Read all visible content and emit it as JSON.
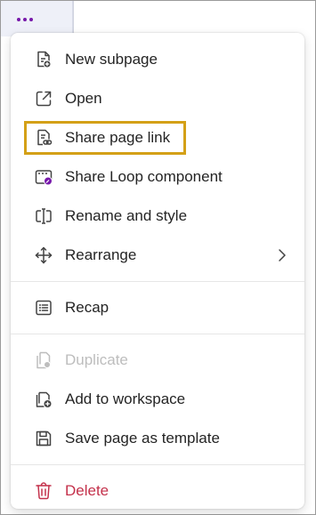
{
  "colors": {
    "accent": "#7719aa",
    "highlight_border": "#d4a017",
    "danger": "#c4314b",
    "disabled": "#bdbdbd"
  },
  "toolbar": {
    "more_icon": "more-horizontal-icon"
  },
  "menu": {
    "groups": [
      [
        {
          "label": "New subpage",
          "icon": "new-subpage-icon"
        },
        {
          "label": "Open",
          "icon": "open-external-icon"
        },
        {
          "label": "Share page link",
          "icon": "share-link-icon",
          "highlighted": true
        },
        {
          "label": "Share Loop component",
          "icon": "loop-component-icon"
        },
        {
          "label": "Rename and style",
          "icon": "rename-icon"
        },
        {
          "label": "Rearrange",
          "icon": "arrange-move-icon",
          "submenu": true
        }
      ],
      [
        {
          "label": "Recap",
          "icon": "recap-list-icon"
        }
      ],
      [
        {
          "label": "Duplicate",
          "icon": "duplicate-icon",
          "disabled": true
        },
        {
          "label": "Add to workspace",
          "icon": "add-to-workspace-icon"
        },
        {
          "label": "Save page as template",
          "icon": "save-template-icon"
        }
      ],
      [
        {
          "label": "Delete",
          "icon": "trash-icon",
          "danger": true
        }
      ]
    ]
  }
}
